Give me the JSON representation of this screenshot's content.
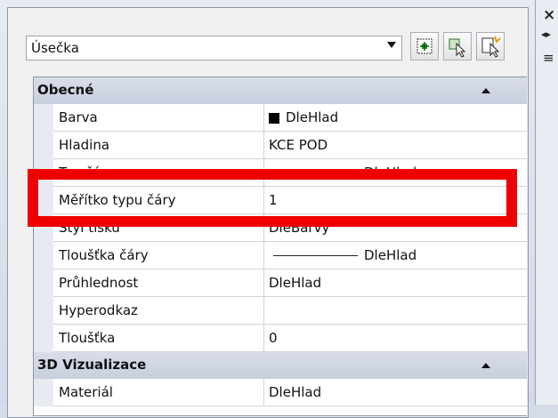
{
  "selector": {
    "value": "Úsečka"
  },
  "sidebar": {
    "close_icon": "×",
    "expand_icon": "◂▸",
    "menu_icon": "≡"
  },
  "toolbar": {
    "buttons": [
      "toggle-pickadd-icon",
      "select-objects-icon",
      "quick-select-icon"
    ]
  },
  "sections": [
    {
      "title": "Obecné",
      "rows": [
        {
          "name": "Barva",
          "value": "DleHlad",
          "swatch": "#000000"
        },
        {
          "name": "Hladina",
          "value": "KCE POD"
        },
        {
          "name": "Typ čáry",
          "value": "DleHlad"
        },
        {
          "name": "Měřítko typu čáry",
          "value": "1"
        },
        {
          "name": "Styl tisku",
          "value": "DleBarvy"
        },
        {
          "name": "Tloušťka čáry",
          "value": "DleHlad"
        },
        {
          "name": "Průhlednost",
          "value": "DleHlad"
        },
        {
          "name": "Hyperodkaz",
          "value": ""
        },
        {
          "name": "Tloušťka",
          "value": "0"
        }
      ]
    },
    {
      "title": "3D Vizualizace",
      "rows": [
        {
          "name": "Materiál",
          "value": "DleHlad"
        }
      ]
    }
  ],
  "highlight_color": "#ee0000"
}
